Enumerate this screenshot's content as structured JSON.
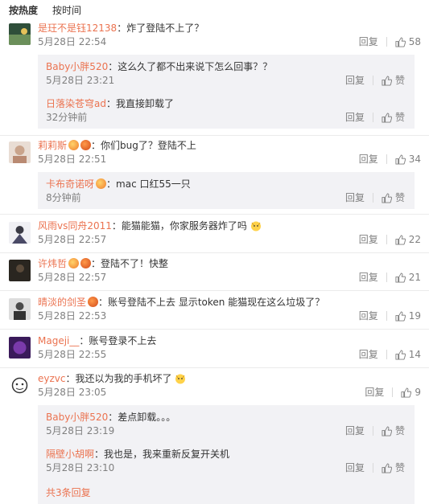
{
  "tabs": [
    {
      "label": "按热度",
      "active": true
    },
    {
      "label": "按时间",
      "active": false
    }
  ],
  "actions": {
    "reply": "回复",
    "like_zan": "赞"
  },
  "comments": [
    {
      "user": "是玨不是钰12138",
      "text": "炸了登陆不上了？",
      "time": "5月28日 22:54",
      "likes": "58",
      "avatar_color": "#2f4f3a",
      "badges": [],
      "replies": [
        {
          "user": "Baby小胖520",
          "text": "这么久了都不出来说下怎么回事？？",
          "time": "5月28日 23:21"
        },
        {
          "user": "日落染苍穹ad",
          "text": "我直接卸载了",
          "time": "32分钟前"
        }
      ]
    },
    {
      "user": "莉莉斯",
      "text": "你们bug了？登陆不上",
      "time": "5月28日 22:51",
      "likes": "34",
      "avatar_color": "#c9a48c",
      "badges": [
        "vip",
        "pumpkin"
      ],
      "replies": [
        {
          "user": "卡布奇诺呀",
          "text": "mac 口红55一只",
          "time": "8分钟前",
          "badges": [
            "vip"
          ]
        }
      ]
    },
    {
      "user": "风雨vs同舟2011",
      "text": "能猫能猫，你家服务器炸了吗",
      "time": "5月28日 22:57",
      "likes": "22",
      "avatar_color": "#3a3a44",
      "badges": [],
      "replies": []
    },
    {
      "user": "许炜哲",
      "text": "登陆不了！快整",
      "time": "5月28日 22:57",
      "likes": "21",
      "avatar_color": "#2a2620",
      "badges": [
        "vip",
        "pumpkin"
      ],
      "replies": []
    },
    {
      "user": "晴淡的剑圣",
      "text": "账号登陆不上去 显示token 能猫现在这么垃圾了？",
      "time": "5月28日 22:53",
      "likes": "19",
      "avatar_color": "#4a4a4a",
      "badges": [
        "pumpkin"
      ],
      "replies": []
    },
    {
      "user": "Mageji__",
      "text": "账号登录不上去",
      "time": "5月28日 22:55",
      "likes": "14",
      "avatar_color": "#5a2a7a",
      "badges": [],
      "replies": []
    },
    {
      "user": "eyzvc",
      "text": "我还以为我的手机坏了",
      "time": "5月28日 23:05",
      "likes": "9",
      "avatar_color": "#e8e8e8",
      "badges": [],
      "replies": [
        {
          "user": "Baby小胖520",
          "text": "差点卸载。。。",
          "time": "5月28日 23:19"
        },
        {
          "user": "隔壁小胡啊",
          "text": "我也是，我来重新反复开关机",
          "time": "5月28日 23:10"
        }
      ],
      "more_replies": "共3条回复"
    }
  ]
}
